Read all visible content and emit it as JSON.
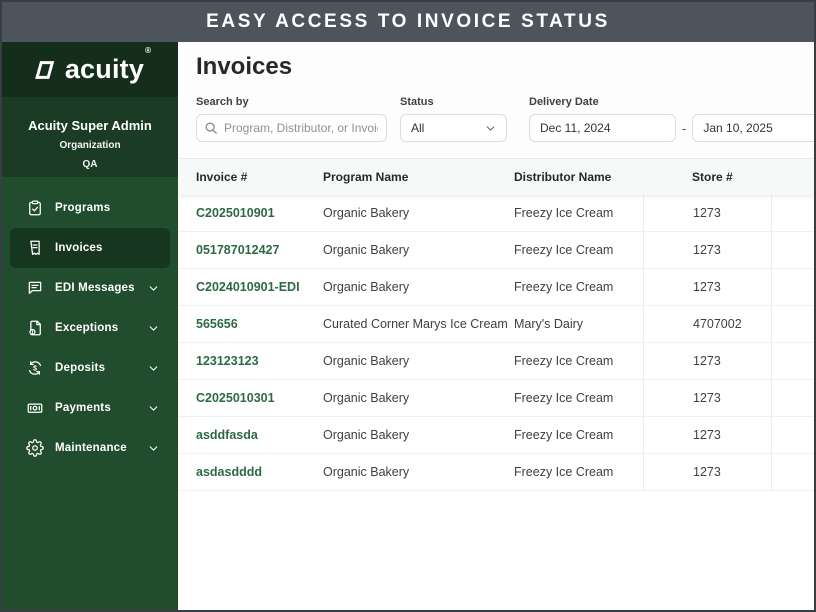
{
  "banner": {
    "title": "EASY ACCESS TO INVOICE STATUS"
  },
  "sidebar": {
    "logo": {
      "brand": "acuity",
      "registered": "®"
    },
    "account": {
      "name": "Acuity Super Admin",
      "org_label": "Organization",
      "org_value": "QA"
    },
    "items": [
      {
        "label": "Programs",
        "icon": "clipboard-check-icon",
        "expandable": false,
        "active": false
      },
      {
        "label": "Invoices",
        "icon": "invoice-receipt-icon",
        "expandable": false,
        "active": true
      },
      {
        "label": "EDI Messages",
        "icon": "chat-message-icon",
        "expandable": true,
        "active": false
      },
      {
        "label": "Exceptions",
        "icon": "document-alert-icon",
        "expandable": true,
        "active": false
      },
      {
        "label": "Deposits",
        "icon": "deposit-cycle-icon",
        "expandable": true,
        "active": false
      },
      {
        "label": "Payments",
        "icon": "banknote-icon",
        "expandable": true,
        "active": false
      },
      {
        "label": "Maintenance",
        "icon": "gear-icon",
        "expandable": true,
        "active": false
      }
    ]
  },
  "main": {
    "title": "Invoices",
    "filters": {
      "search": {
        "label": "Search by",
        "placeholder": "Program, Distributor, or Invoice #"
      },
      "status": {
        "label": "Status",
        "value": "All"
      },
      "delivery_date": {
        "label": "Delivery Date",
        "from": "Dec 11, 2024",
        "separator": "-",
        "to": "Jan 10, 2025"
      }
    },
    "table": {
      "columns": [
        "Invoice #",
        "Program Name",
        "Distributor Name",
        "Store #"
      ],
      "rows": [
        [
          "C2025010901",
          "Organic Bakery",
          "Freezy Ice Cream",
          "1273"
        ],
        [
          "051787012427",
          "Organic Bakery",
          "Freezy Ice Cream",
          "1273"
        ],
        [
          "C2024010901-EDI",
          "Organic Bakery",
          "Freezy Ice Cream",
          "1273"
        ],
        [
          "565656",
          "Curated Corner Marys Ice Cream",
          "Mary's Dairy",
          "4707002"
        ],
        [
          "123123123",
          "Organic Bakery",
          "Freezy Ice Cream",
          "1273"
        ],
        [
          "C2025010301",
          "Organic Bakery",
          "Freezy Ice Cream",
          "1273"
        ],
        [
          "asddfasda",
          "Organic Bakery",
          "Freezy Ice Cream",
          "1273"
        ],
        [
          "asdasdddd",
          "Organic Bakery",
          "Freezy Ice Cream",
          "1273"
        ]
      ]
    }
  },
  "colors": {
    "banner_bg": "#4d545c",
    "sidebar_logo_bg": "#152e1c",
    "sidebar_account_bg": "#1c3b25",
    "sidebar_nav_bg": "#214c2e",
    "sidebar_active_bg": "#17361f",
    "link_green": "#2d6a43",
    "header_row_bg": "#f7f9f8"
  }
}
